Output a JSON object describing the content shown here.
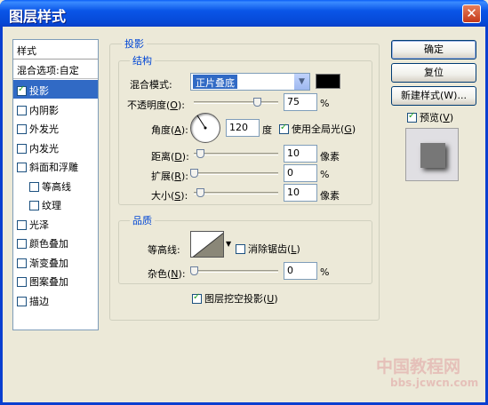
{
  "window": {
    "title": "图层样式",
    "close_glyph": "✕"
  },
  "left_list": {
    "header": "样式",
    "blend_options": "混合选项:自定",
    "items": [
      {
        "label": "投影",
        "checked": true,
        "selected": true
      },
      {
        "label": "内阴影",
        "checked": false
      },
      {
        "label": "外发光",
        "checked": false
      },
      {
        "label": "内发光",
        "checked": false
      },
      {
        "label": "斜面和浮雕",
        "checked": false
      },
      {
        "label": "等高线",
        "checked": false,
        "sub": true
      },
      {
        "label": "纹理",
        "checked": false,
        "sub": true
      },
      {
        "label": "光泽",
        "checked": false
      },
      {
        "label": "颜色叠加",
        "checked": false
      },
      {
        "label": "渐变叠加",
        "checked": false
      },
      {
        "label": "图案叠加",
        "checked": false
      },
      {
        "label": "描边",
        "checked": false
      }
    ]
  },
  "drop_shadow": {
    "title": "投影",
    "structure": {
      "title": "结构",
      "blend_mode_label_pre": "混合模式",
      "blend_mode_label_post": ":",
      "blend_mode_value": "正片叠底",
      "opacity_label_pre": "不透明度(",
      "opacity_key": "O",
      "opacity_label_post": "):",
      "opacity_value": "75",
      "opacity_unit": "%",
      "angle_label_pre": "角度(",
      "angle_key": "A",
      "angle_label_post": "):",
      "angle_value": "120",
      "angle_unit": "度",
      "global_light_label_pre": "使用全局光(",
      "global_light_key": "G",
      "global_light_label_post": ")",
      "global_light_checked": true,
      "distance_label_pre": "距离(",
      "distance_key": "D",
      "distance_label_post": "):",
      "distance_value": "10",
      "distance_unit": "像素",
      "spread_label_pre": "扩展(",
      "spread_key": "R",
      "spread_label_post": "):",
      "spread_value": "0",
      "spread_unit": "%",
      "size_label_pre": "大小(",
      "size_key": "S",
      "size_label_post": "):",
      "size_value": "10",
      "size_unit": "像素"
    },
    "quality": {
      "title": "品质",
      "contour_label": "等高线:",
      "antialias_label_pre": "消除锯齿(",
      "antialias_key": "L",
      "antialias_label_post": ")",
      "antialias_checked": false,
      "noise_label_pre": "杂色(",
      "noise_key": "N",
      "noise_label_post": "):",
      "noise_value": "0",
      "noise_unit": "%"
    },
    "knockout_label_pre": "图层挖空投影(",
    "knockout_key": "U",
    "knockout_label_post": ")",
    "knockout_checked": true
  },
  "buttons": {
    "ok": "确定",
    "reset": "复位",
    "new_style": "新建样式(W)...",
    "preview_label_pre": "预览(",
    "preview_key": "V",
    "preview_label_post": ")",
    "preview_checked": true
  },
  "watermark": {
    "line1": "中国教程网",
    "line2": "bbs.jcwcn.com"
  },
  "colors": {
    "title_blue": "#0A56E8",
    "selection": "#316AC5",
    "group_title": "#0046D5",
    "shadow_color": "#000000"
  }
}
